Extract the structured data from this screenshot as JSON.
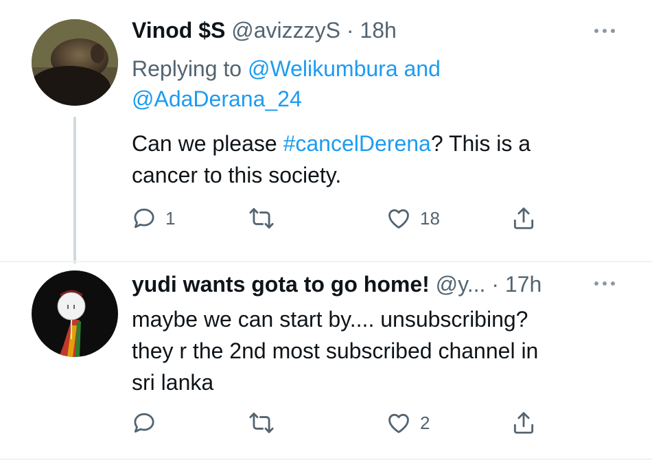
{
  "tweets": [
    {
      "name": "Vinod $S",
      "handle": "@avizzzyS",
      "separator": " · ",
      "time": "18h",
      "reply_prefix": "Replying to ",
      "reply_user1": "@Welikumbura",
      "reply_and": " and",
      "reply_user2": "@AdaDerana_24",
      "text_before": "Can we please ",
      "hashtag": "#cancelDerena",
      "text_after": "? This is a",
      "text_line2": "cancer to this society.",
      "reply_count": "1",
      "retweet_count": "",
      "like_count": "18"
    },
    {
      "name": "yudi wants gota to go home!",
      "handle": "@y...",
      "separator": " · ",
      "time": "17h",
      "text_line1": "maybe we can start by.... unsubscribing?",
      "text_line2": "they r the 2nd most subscribed channel in",
      "text_line3": "sri lanka",
      "reply_count": "",
      "retweet_count": "",
      "like_count": "2"
    }
  ],
  "icons": {
    "more": "more-icon",
    "reply": "reply-icon",
    "retweet": "retweet-icon",
    "like": "like-icon",
    "share": "share-icon"
  },
  "colors": {
    "link": "#1d9bf0",
    "secondary_text": "#536471",
    "primary_text": "#0f1419",
    "thread_line": "#cfd9de"
  }
}
